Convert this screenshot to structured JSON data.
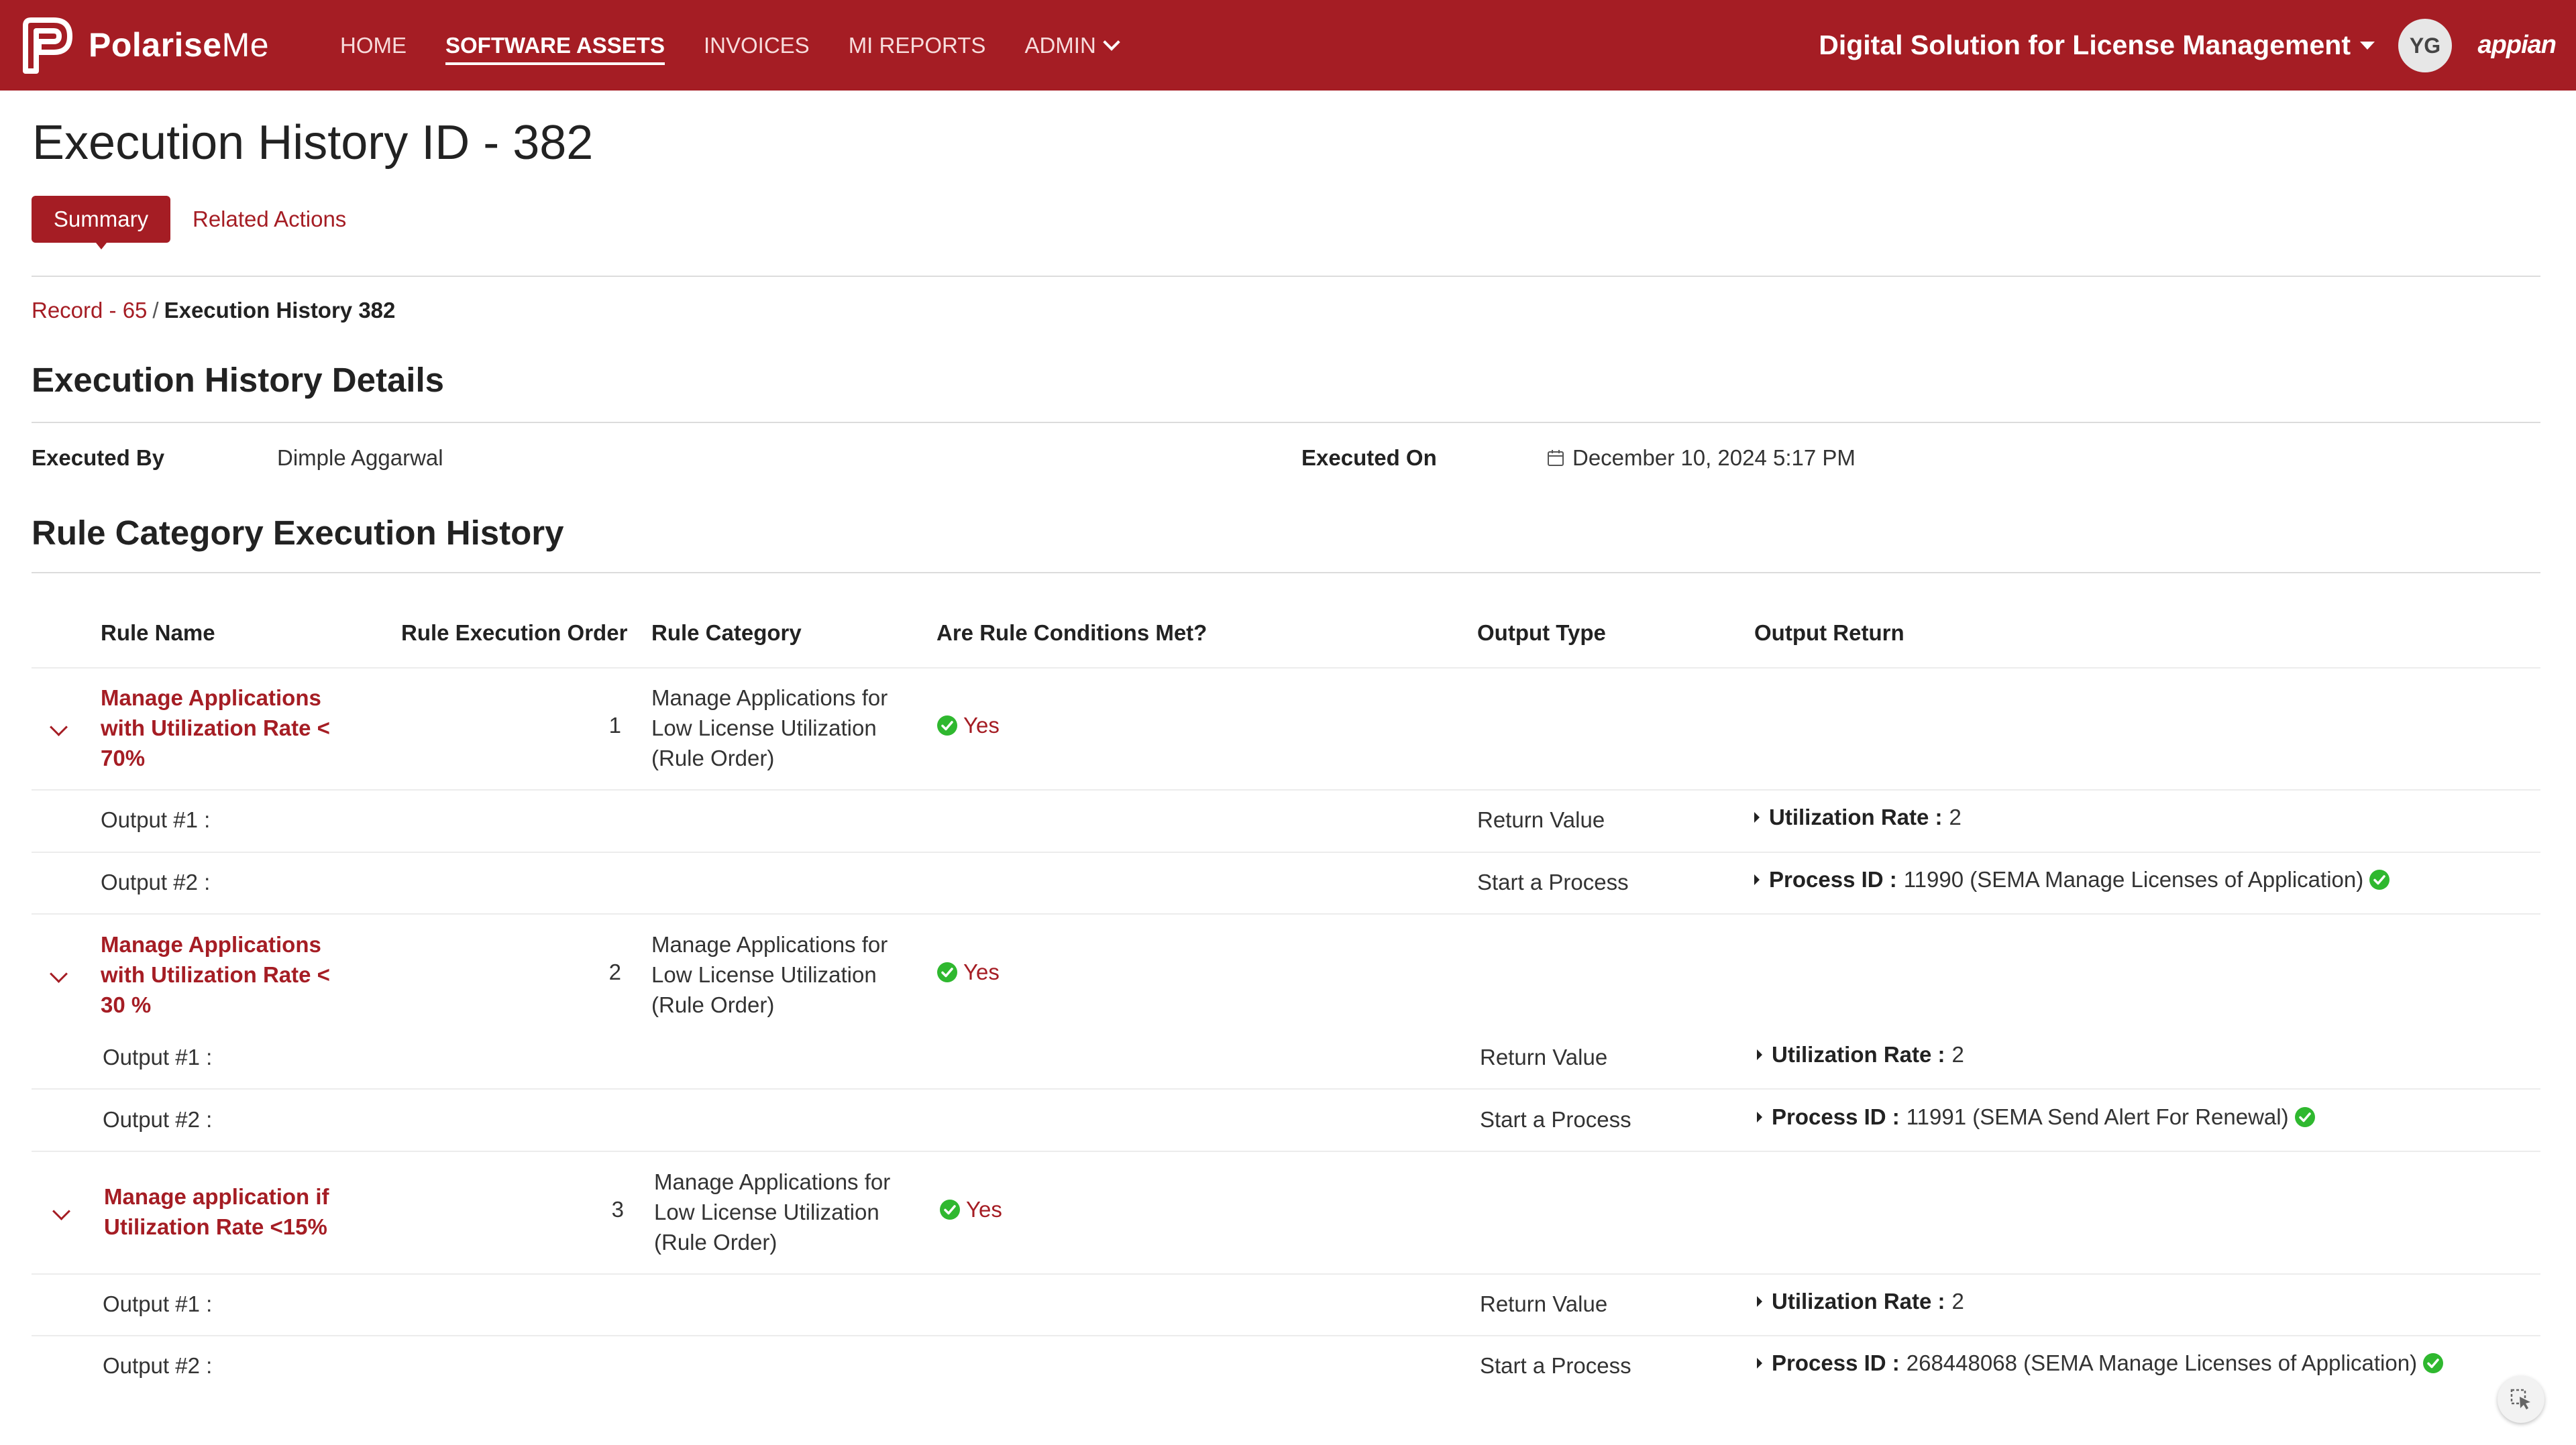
{
  "app": {
    "brand_left": "Polarise",
    "brand_right": "Me",
    "site_title": "Digital Solution for License Management",
    "user_initials": "YG",
    "platform": "appian"
  },
  "nav": {
    "items": [
      {
        "label": "HOME"
      },
      {
        "label": "SOFTWARE ASSETS"
      },
      {
        "label": "INVOICES"
      },
      {
        "label": "MI REPORTS"
      },
      {
        "label": "ADMIN"
      }
    ],
    "active": "SOFTWARE ASSETS"
  },
  "page": {
    "title": "Execution History ID - 382",
    "tabs": [
      {
        "label": "Summary"
      },
      {
        "label": "Related Actions"
      }
    ],
    "breadcrumb": {
      "link": "Record - 65",
      "separator": "/",
      "current": "Execution History 382"
    }
  },
  "details": {
    "title": "Execution History Details",
    "executed_by_label": "Executed By",
    "executed_by_value": "Dimple Aggarwal",
    "executed_on_label": "Executed On",
    "executed_on_value": "December 10, 2024 5:17 PM"
  },
  "rules": {
    "title": "Rule Category Execution History",
    "columns": [
      "Rule Name",
      "Rule Execution Order",
      "Rule Category",
      "Are Rule Conditions Met?",
      "Output Type",
      "Output Return"
    ],
    "groups": [
      {
        "name": "Manage Applications with Utilization Rate < 70%",
        "name_lines": [
          "Manage Applications",
          "with Utilization Rate <",
          "70%"
        ],
        "order": "1",
        "category_lines": [
          "Manage Applications for",
          "Low License Utilization",
          "(Rule Order)"
        ],
        "met": "Yes",
        "outputs": [
          {
            "label": "Output #1 :",
            "type": "Return Value",
            "key": "Utilization Rate :",
            "value": "2",
            "ok": false
          },
          {
            "label": "Output #2 :",
            "type": "Start a Process",
            "key": "Process ID :",
            "value": "11990 (SEMA Manage Licenses of Application)",
            "ok": true
          }
        ]
      },
      {
        "name": "Manage Applications with Utilization Rate < 30 %",
        "name_lines": [
          "Manage Applications",
          "with Utilization Rate <",
          "30 %"
        ],
        "order": "2",
        "category_lines": [
          "Manage Applications for",
          "Low License Utilization",
          "(Rule Order)"
        ],
        "met": "Yes",
        "outputs": [
          {
            "label": "Output #1 :",
            "type": "Return Value",
            "key": "Utilization Rate :",
            "value": "2",
            "ok": false
          },
          {
            "label": "Output #2 :",
            "type": "Start a Process",
            "key": "Process ID :",
            "value": "11991 (SEMA Send Alert For Renewal)",
            "ok": true
          }
        ]
      },
      {
        "name": "Manage application if Utilization Rate <15%",
        "name_lines": [
          "Manage application if",
          "Utilization Rate <15%"
        ],
        "order": "3",
        "category_lines": [
          "Manage Applications for",
          "Low License Utilization",
          "(Rule Order)"
        ],
        "met": "Yes",
        "outputs": [
          {
            "label": "Output #1 :",
            "type": "Return Value",
            "key": "Utilization Rate :",
            "value": "2",
            "ok": false
          },
          {
            "label": "Output #2 :",
            "type": "Start a Process",
            "key": "Process ID :",
            "value": "268448068 (SEMA Manage Licenses of Application)",
            "ok": true
          }
        ]
      }
    ]
  },
  "colors": {
    "primary": "#a51d24",
    "success": "#2fb82f"
  },
  "icons": {
    "calendar": "calendar-icon",
    "check": "check-circle-icon",
    "expand": "chevron-down-icon",
    "expand_output": "caret-right-icon",
    "corner": "cursor-select-icon"
  }
}
